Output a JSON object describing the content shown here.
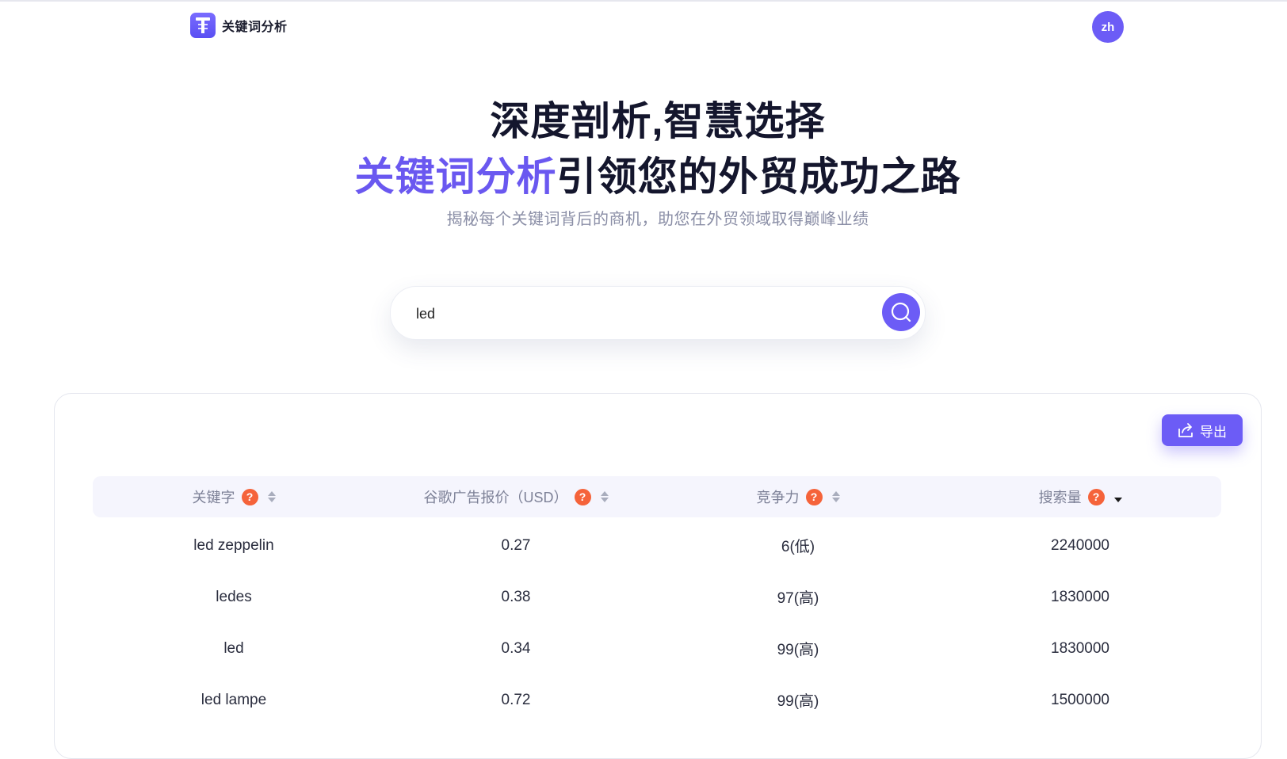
{
  "header": {
    "brand_name": "关键词分析",
    "avatar_text": "zh"
  },
  "hero": {
    "title": "深度剖析,智慧选择",
    "line2_accent": "关键词分析",
    "line2_rest": "引领您的外贸成功之路",
    "subtitle": "揭秘每个关键词背后的商机，助您在外贸领域取得巅峰业绩"
  },
  "search": {
    "value": "led",
    "placeholder": ""
  },
  "toolbar": {
    "export_label": "导出"
  },
  "table": {
    "columns": [
      {
        "label": "关键字",
        "sort": "none"
      },
      {
        "label": "谷歌广告报价（USD）",
        "sort": "none"
      },
      {
        "label": "竞争力",
        "sort": "none"
      },
      {
        "label": "搜索量",
        "sort": "desc"
      }
    ],
    "help_glyph": "?",
    "rows": [
      {
        "keyword": "led zeppelin",
        "price": "0.27",
        "competition": "6(低)",
        "volume": "2240000"
      },
      {
        "keyword": "ledes",
        "price": "0.38",
        "competition": "97(高)",
        "volume": "1830000"
      },
      {
        "keyword": "led",
        "price": "0.34",
        "competition": "99(高)",
        "volume": "1830000"
      },
      {
        "keyword": "led lampe",
        "price": "0.72",
        "competition": "99(高)",
        "volume": "1500000"
      }
    ]
  },
  "colors": {
    "accent": "#6c5cf6",
    "help_badge": "#f5633a",
    "title_dark": "#14162d"
  },
  "icons": [
    "brand-logo-icon",
    "search-icon",
    "export-icon",
    "help-icon",
    "sort-icon"
  ]
}
